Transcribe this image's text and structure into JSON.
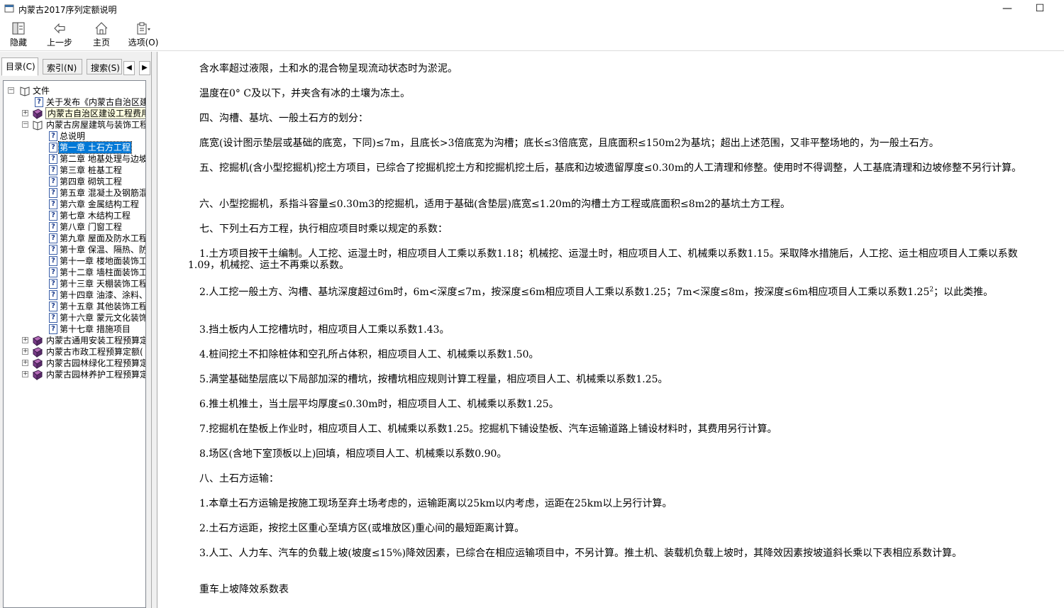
{
  "window": {
    "title": "内蒙古2017序列定额说明",
    "minimize": "—",
    "maximize": "☐"
  },
  "toolbar": {
    "hide": "隐藏",
    "back": "上一步",
    "home": "主页",
    "options": "选项(O)"
  },
  "tabs": {
    "toc": "目录(C)",
    "index": "索引(N)",
    "search": "搜索(S)"
  },
  "tree": {
    "root": "文件",
    "items": [
      "关于发布《内蒙古自治区建",
      "内蒙古自治区建设工程费用定额",
      "内蒙古房屋建筑与装饰工程",
      "总说明",
      "第一章 土石方工程",
      "第二章 地基处理与边坡",
      "第三章 桩基工程",
      "第四章 砌筑工程",
      "第五章 混凝土及钢筋混",
      "第六章 金属结构工程",
      "第七章 木结构工程",
      "第八章 门窗工程",
      "第九章 屋面及防水工程",
      "第十章 保温、隔热、防",
      "第十一章 楼地面装饰工",
      "第十二章 墙柱面装饰工",
      "第十三章 天棚装饰工程",
      "第十四章 油漆、涂料、",
      "第十五章 其他装饰工程",
      "第十六章 蒙元文化装饰",
      "第十七章 措施项目",
      "内蒙古通用安装工程预算定",
      "内蒙古市政工程预算定额(",
      "内蒙古园林绿化工程预算定",
      "内蒙古园林养护工程预算定"
    ]
  },
  "content": {
    "p1": "含水率超过液限，土和水的混合物呈现流动状态时为淤泥。",
    "p2": "温度在0° C及以下，并夹含有冰的土壤为冻土。",
    "p3": "四、沟槽、基坑、一般土石方的划分：",
    "p4": "底宽(设计图示垫层或基础的底宽，下同)≤7m，且底长>3倍底宽为沟槽；底长≤3倍底宽，且底面积≤150m2为基坑；超出上述范围，又非平整场地的，为一般土石方。",
    "p5": "五、挖掘机(含小型挖掘机)挖土方项目，已综合了挖掘机挖土方和挖掘机挖土后，基底和边坡遗留厚度≤0.30m的人工清理和修整。使用时不得调整，人工基底清理和边坡修整不另行计算。",
    "p6": "六、小型挖掘机，系指斗容量≤0.30m3的挖掘机，适用于基础(含垫层)底宽≤1.20m的沟槽土方工程或底面积≤8m2的基坑土方工程。",
    "p7": "七、下列土石方工程，执行相应项目时乘以规定的系数：",
    "p8": "1.土方项目按干土编制。人工挖、运湿土时，相应项目人工乘以系数1.18；机械挖、运湿土时，相应项目人工、机械乘以系数1.15。采取降水措施后，人工挖、运土相应项目人工乘以系数1.09，机械挖、运土不再乘以系数。",
    "p9a": "2.人工挖一般土方、沟槽、基坑深度超过6m时，6m<深度≤7m，按深度≤6m相应项目人工乘以系数1.25；7m<深度≤8m，按深度≤6m相应项目人工乘以系数1.25",
    "p9sup": "2",
    "p9b": "；以此类推。",
    "p10": "3.挡土板内人工挖槽坑时，相应项目人工乘以系数1.43。",
    "p11": "4.桩间挖土不扣除桩体和空孔所占体积，相应项目人工、机械乘以系数1.50。",
    "p12": "5.满堂基础垫层底以下局部加深的槽坑，按槽坑相应规则计算工程量，相应项目人工、机械乘以系数1.25。",
    "p13": "6.推土机推土，当土层平均厚度≤0.30m时，相应项目人工、机械乘以系数1.25。",
    "p14": "7.挖掘机在垫板上作业时，相应项目人工、机械乘以系数1.25。挖掘机下铺设垫板、汽车运输道路上铺设材料时，其费用另行计算。",
    "p15": "8.场区(含地下室顶板以上)回填，相应项目人工、机械乘以系数0.90。",
    "p16": "八、土石方运输：",
    "p17": "1.本章土石方运输是按施工现场至弃土场考虑的，运输距离以25km以内考虑，运距在25km以上另行计算。",
    "p18": "2.土石方运距，按挖土区重心至填方区(或堆放区)重心间的最短距离计算。",
    "p19": "3.人工、人力车、汽车的负载上坡(坡度≤15%)降效因素，已综合在相应运输项目中，不另计算。推土机、装载机负载上坡时，其降效因素按坡道斜长乘以下表相应系数计算。",
    "p20": "重车上坡降效系数表"
  }
}
